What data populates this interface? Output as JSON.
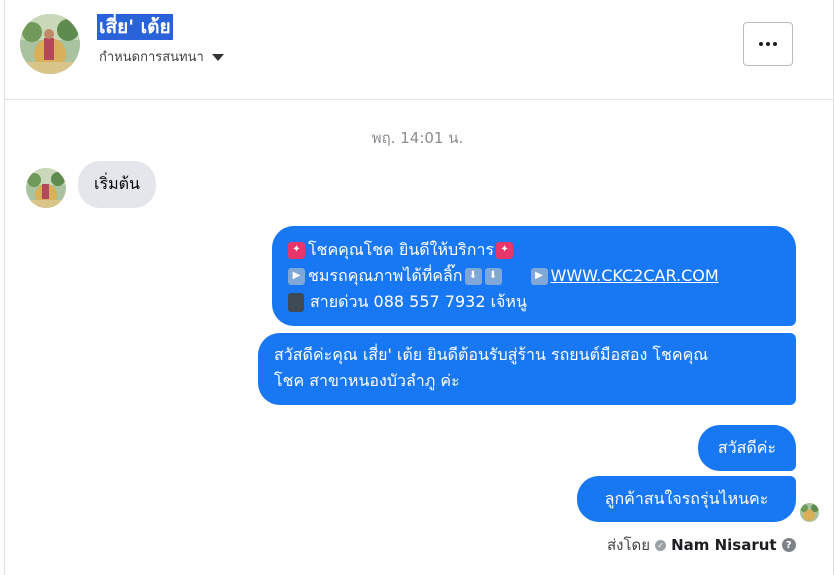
{
  "header": {
    "contact_name": "เสี่ย' เต้ย",
    "conversation_settings": "กำหนดการสนทนา",
    "more_icon": "more-horizontal-icon"
  },
  "thread": {
    "timestamp": "พฤ. 14:01 น.",
    "incoming": {
      "text": "เริ่มต้น"
    },
    "outgoing": {
      "b1_line1": "โชคคุณโชค ยินดีให้บริการ",
      "b1_line2": "ชมรถคุณภาพได้ที่คลิ๊ก",
      "b1_link": "WWW.CKC2CAR.COM",
      "b1_line3": "สายด่วน 088 557 7932 เจ้หนู",
      "b2_line1": "สวัสดีค่ะคุณ เสี่ย' เต้ย ยินดีต้อนรับสู่ร้าน รถยนต์มือสอง โชคคุณ",
      "b2_line2": "โชค สาขาหนองบัวลำภู ค่ะ",
      "b3": "สวัสดีค่ะ",
      "b4": "ลูกค้าสนใจรถรุ่นไหนคะ"
    },
    "sent_by_label": "ส่งโดย",
    "sent_by_name": "Nam Nisarut"
  },
  "colors": {
    "outgoing_bubble": "#1877f2",
    "incoming_bubble": "#e4e6eb",
    "name_highlight": "#2962d9"
  }
}
